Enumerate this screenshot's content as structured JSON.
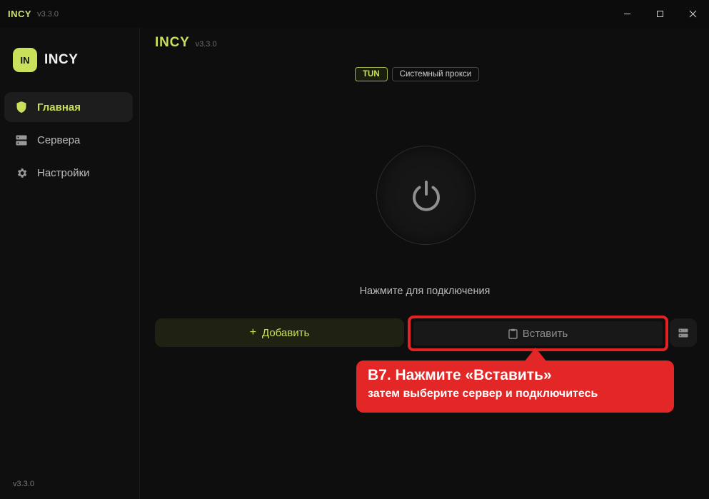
{
  "window": {
    "title": "INCY",
    "version": "v3.3.0",
    "controls": [
      "minimize-icon",
      "maximize-icon",
      "close-icon"
    ]
  },
  "sidebar": {
    "brand_logo": "IN",
    "brand_name": "INCY",
    "items": [
      {
        "label": "Главная",
        "icon": "shield-icon",
        "active": true
      },
      {
        "label": "Сервера",
        "icon": "server-icon",
        "active": false
      },
      {
        "label": "Настройки",
        "icon": "gear-icon",
        "active": false
      }
    ],
    "version": "v3.3.0"
  },
  "main": {
    "title": "INCY",
    "version": "v3.3.0",
    "modes": [
      {
        "label": "TUN",
        "active": true
      },
      {
        "label": "Системный прокси",
        "active": false
      }
    ],
    "power_icon": "power-icon",
    "hint": "Нажмите для подключения",
    "add_label": "Добавить",
    "paste_label": "Вставить",
    "list_icon": "server-list-icon"
  },
  "callout": {
    "title": "B7. Нажмите «Вставить»",
    "subtitle": "затем выберите сервер и подключитесь"
  },
  "colors": {
    "accent": "#c8e05a",
    "background": "#0e0e0e",
    "callout": "#e32626"
  }
}
